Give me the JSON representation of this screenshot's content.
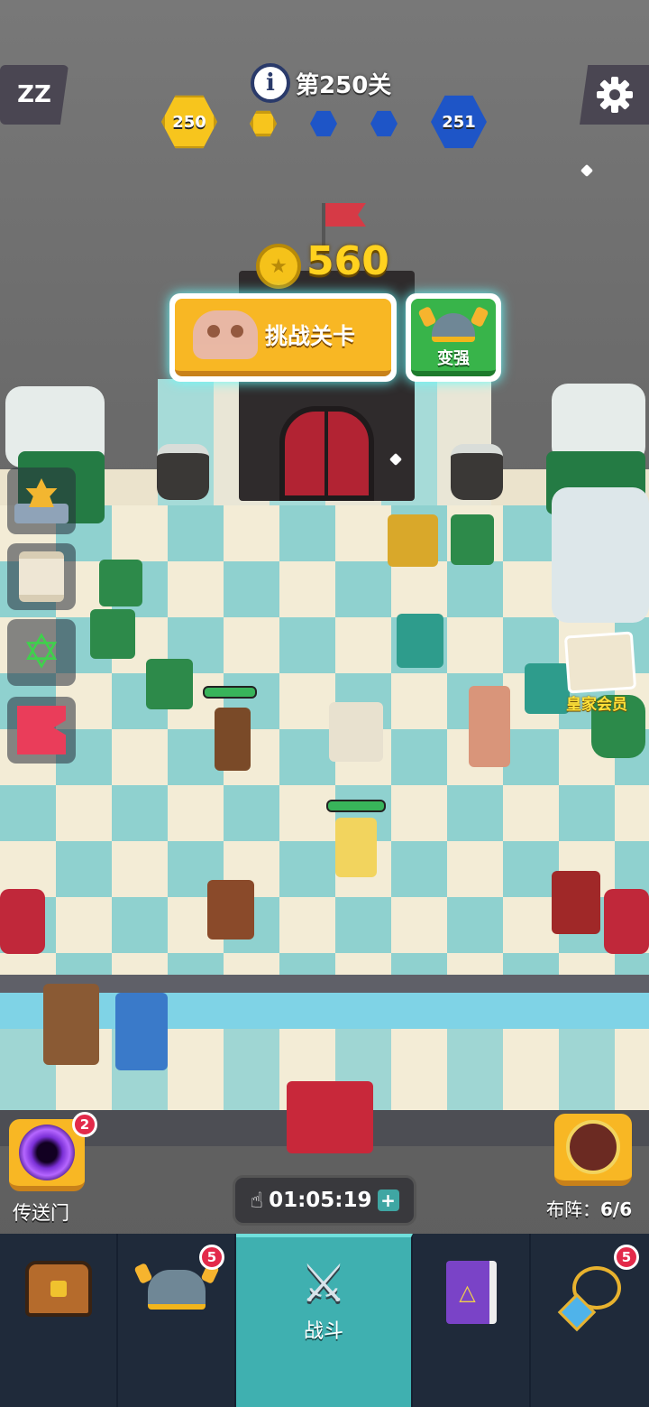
{
  "hud": {
    "level": {
      "prefix": "第",
      "number": "250",
      "suffix": "关"
    },
    "progress": {
      "current_level": "250",
      "next_level": "251",
      "stages_done": 1,
      "stages_total": 3
    },
    "sleep_icon": "ZZ",
    "settings_icon": "gear-icon",
    "info_icon": "i"
  },
  "challenge": {
    "coin_value": "560",
    "challenge_label": "挑战关卡",
    "upgrade_label": "变强"
  },
  "side": {
    "items": [
      "ranking-icon",
      "quest-scroll-icon",
      "hexagram-icon",
      "banner-icon"
    ],
    "royal_label": "皇家会员"
  },
  "portal": {
    "label": "传送门",
    "badge": "2"
  },
  "formation": {
    "label_prefix": "布阵：",
    "count": "6/6"
  },
  "timer": {
    "value": "01:05:19",
    "plus": "+"
  },
  "nav": {
    "tabs": [
      {
        "icon": "chest-icon"
      },
      {
        "icon": "helmet-icon",
        "badge": "5"
      },
      {
        "icon": "crossed-swords-icon",
        "label": "战斗",
        "active": true
      },
      {
        "icon": "spellbook-icon"
      },
      {
        "icon": "amulet-icon",
        "badge": "5"
      }
    ]
  },
  "colors": {
    "gold": "#f8b724",
    "teal": "#3fb0b0",
    "nav_bg": "#1f2a3a",
    "badge_red": "#e32a4a",
    "blue_hex": "#1e55c7"
  }
}
